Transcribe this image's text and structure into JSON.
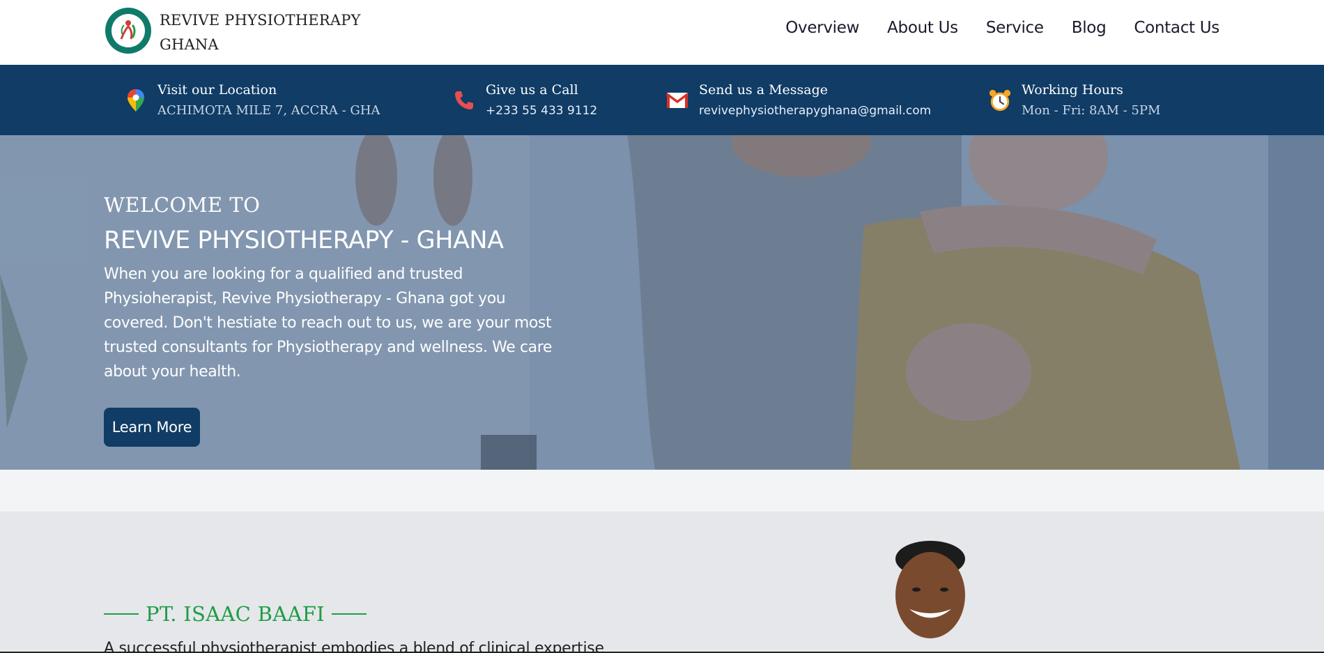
{
  "brand": {
    "name_line1": "REVIVE PHYSIOTHERAPY",
    "name_line2": "GHANA"
  },
  "nav": {
    "items": [
      "Overview",
      "About Us",
      "Service",
      "Blog",
      "Contact Us"
    ]
  },
  "info": {
    "location": {
      "title": "Visit our Location",
      "value": "ACHIMOTA MILE 7, ACCRA - GHA",
      "icon": "map-pin-icon"
    },
    "call": {
      "title": "Give us a Call",
      "value": "+233 55 433 9112",
      "icon": "phone-icon"
    },
    "message": {
      "title": "Send us a Message",
      "value": "revivephysiotherapyghana@gmail.com",
      "icon": "mail-icon"
    },
    "hours": {
      "title": "Working Hours",
      "value": "Mon - Fri: 8AM - 5PM",
      "icon": "alarm-clock-icon"
    }
  },
  "hero": {
    "welcome": "WELCOME TO",
    "title": "REVIVE PHYSIOTHERAPY - GHANA",
    "text": "When you are looking for a qualified and trusted Physioherapist, Revive Physiotherapy - Ghana got you covered. Don't hestiate to reach out to us, we are your most trusted consultants for Physiotherapy and wellness. We care about your health.",
    "button": "Learn More"
  },
  "about": {
    "name": "PT. ISAAC BAAFI",
    "text": "A successful physiotherapist embodies a blend of clinical expertise"
  },
  "colors": {
    "primary": "#103c66",
    "accent_green": "#1f9d44",
    "logo_teal": "#0f7a6a"
  }
}
